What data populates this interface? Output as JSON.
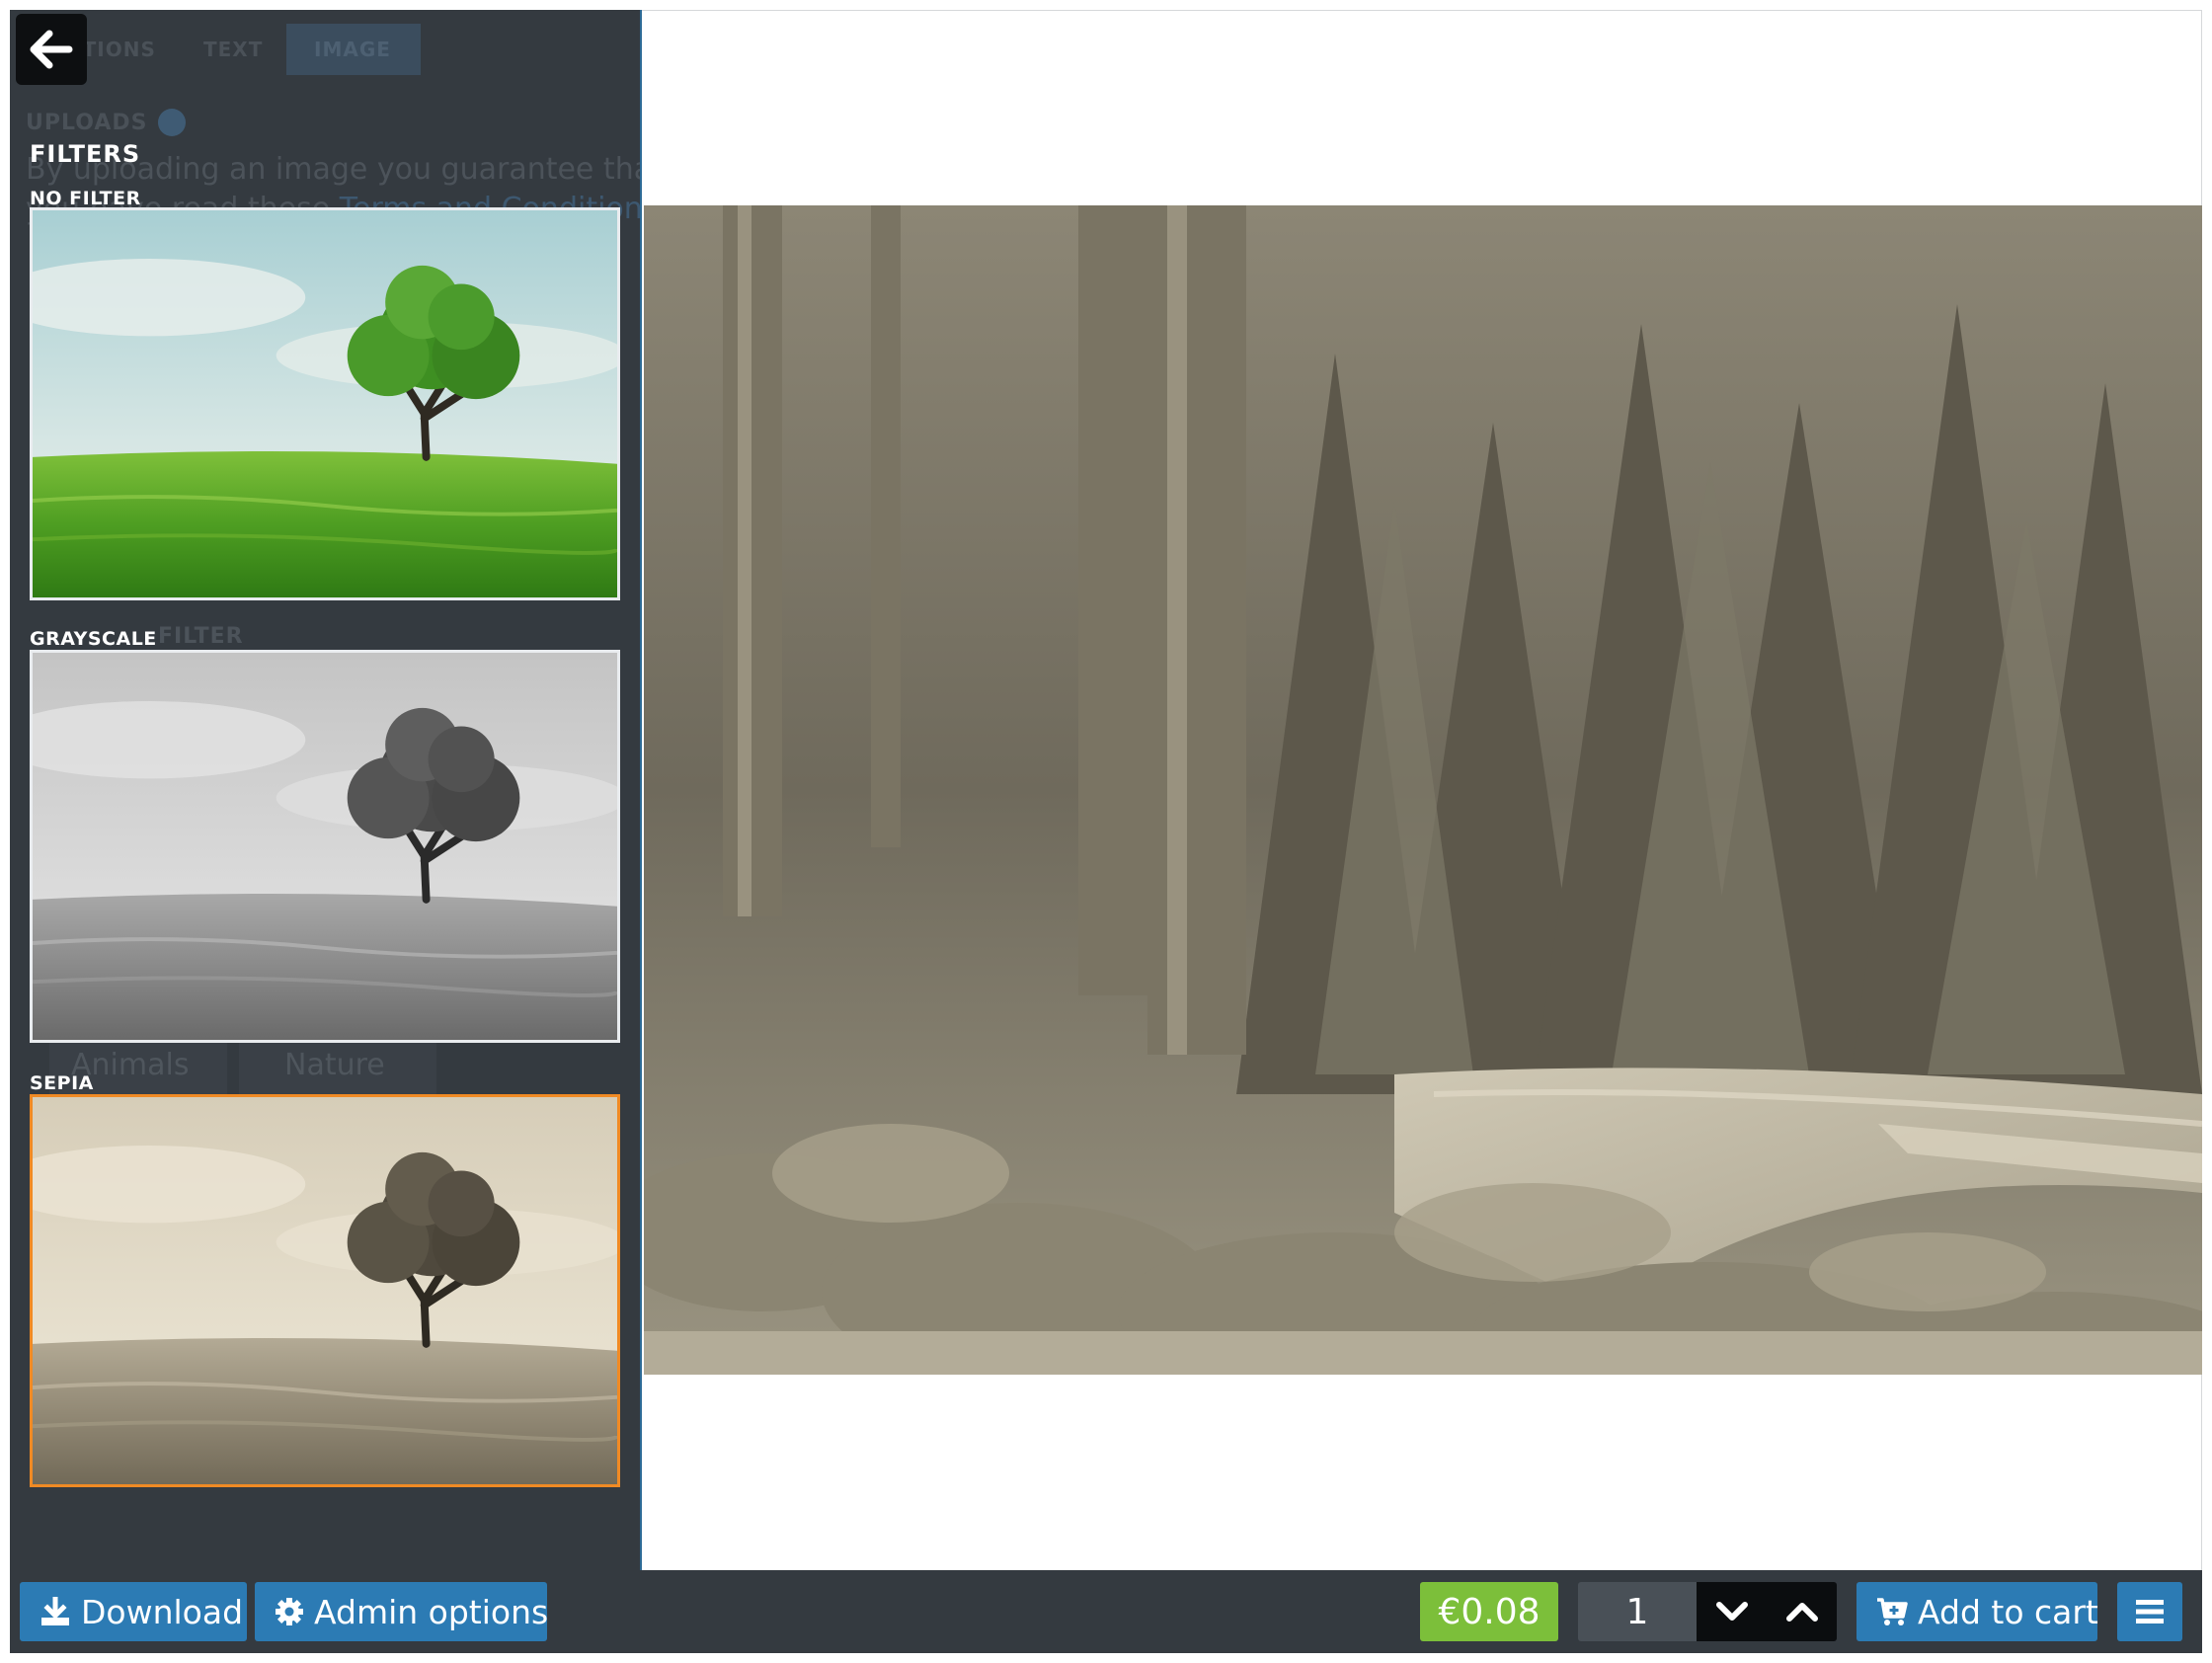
{
  "sidebar": {
    "background_tabs": [
      "OPTIONS",
      "TEXT",
      "IMAGE"
    ],
    "background_uploads_heading": "UPLOADS",
    "background_uploads_text_line1": "By uploading an image you guarantee that",
    "background_uploads_text_line2_prefix": "you have read these ",
    "background_uploads_text_link": "Terms and Conditions",
    "background_filter_heading": "FILTER",
    "background_categories": [
      "Animals",
      "Nature"
    ],
    "back_icon": "arrow-left-icon",
    "filters_title": "FILTERS",
    "filters": [
      {
        "label": "NO FILTER",
        "selected": false
      },
      {
        "label": "GRAYSCALE",
        "selected": false
      },
      {
        "label": "SEPIA",
        "selected": true
      }
    ]
  },
  "canvas": {
    "applied_filter": "SEPIA"
  },
  "toolbar": {
    "download_label": "Download",
    "download_icon": "download-icon",
    "admin_label": "Admin options",
    "admin_icon": "gear-icon",
    "price": "€0.08",
    "quantity": "1",
    "decrease_icon": "chevron-down-icon",
    "increase_icon": "chevron-up-icon",
    "add_to_cart_label": "Add to cart",
    "cart_icon": "cart-plus-icon",
    "menu_icon": "hamburger-menu-icon"
  },
  "colors": {
    "sidebar_bg": "#343a40",
    "button_blue": "#2c7bb4",
    "price_green": "#7cbf3a",
    "selected_border": "#f08a24"
  }
}
